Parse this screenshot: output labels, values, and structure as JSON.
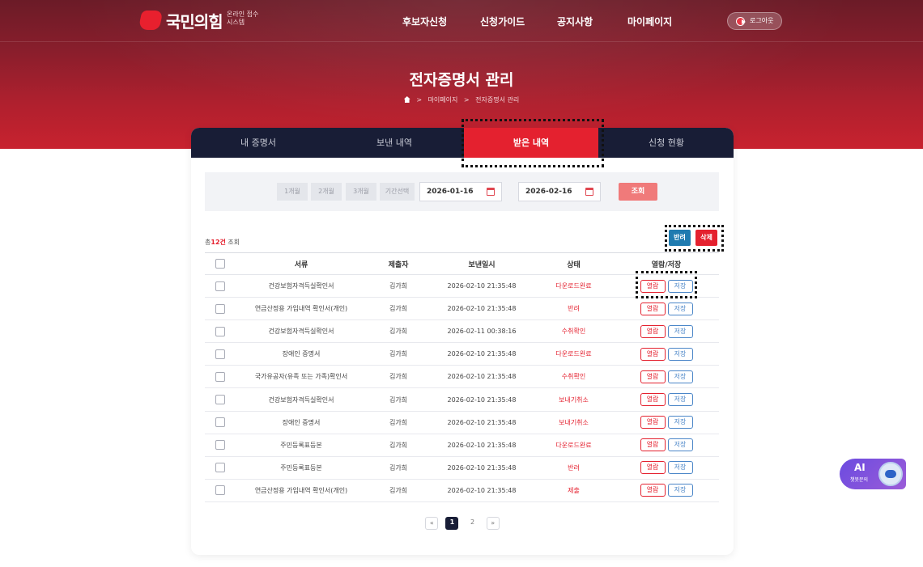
{
  "header": {
    "logo_text": "국민의힘",
    "logo_sub": "온라인 접수 시스템",
    "nav": [
      "후보자신청",
      "신청가이드",
      "공지사항",
      "마이페이지"
    ],
    "logout_label": "로그아웃"
  },
  "page": {
    "title": "전자증명서 관리",
    "breadcrumb": [
      "마이페이지",
      "전자증명서 관리"
    ]
  },
  "tabs": [
    {
      "label": "내 증명서",
      "active": false
    },
    {
      "label": "보낸 내역",
      "active": false
    },
    {
      "label": "받은 내역",
      "active": true
    },
    {
      "label": "신청 현황",
      "active": false
    }
  ],
  "filter": {
    "periods": [
      "1개월",
      "2개월",
      "3개월",
      "기간선택"
    ],
    "start_date": "2026-01-16",
    "end_date": "2026-02-16",
    "search_label": "조회"
  },
  "summary": {
    "prefix": "총",
    "count": "12건",
    "suffix": "조회"
  },
  "actions": {
    "return_label": "반려",
    "delete_label": "삭제"
  },
  "table": {
    "headers": [
      "",
      "서류",
      "제출자",
      "보낸일시",
      "상태",
      "열람/저장"
    ],
    "view_label": "열람",
    "save_label": "저장",
    "rows": [
      {
        "doc": "건강보험자격득실확인서",
        "submitter": "김가희",
        "sent_at": "2026-02-10 21:35:48",
        "status": "다운로드완료"
      },
      {
        "doc": "연금산정용 가입내역 확인서(개인)",
        "submitter": "김가희",
        "sent_at": "2026-02-10 21:35:48",
        "status": "반려"
      },
      {
        "doc": "건강보험자격득실확인서",
        "submitter": "김가희",
        "sent_at": "2026-02-11 00:38:16",
        "status": "수취확인"
      },
      {
        "doc": "장애인 증명서",
        "submitter": "김가희",
        "sent_at": "2026-02-10 21:35:48",
        "status": "다운로드완료"
      },
      {
        "doc": "국가유공자(유족 또는 가족)확인서",
        "submitter": "김가희",
        "sent_at": "2026-02-10 21:35:48",
        "status": "수취확인"
      },
      {
        "doc": "건강보험자격득실확인서",
        "submitter": "김가희",
        "sent_at": "2026-02-10 21:35:48",
        "status": "보내기취소"
      },
      {
        "doc": "장애인 증명서",
        "submitter": "김가희",
        "sent_at": "2026-02-10 21:35:48",
        "status": "보내기취소"
      },
      {
        "doc": "주민등록표등본",
        "submitter": "김가희",
        "sent_at": "2026-02-10 21:35:48",
        "status": "다운로드완료"
      },
      {
        "doc": "주민등록표등본",
        "submitter": "김가희",
        "sent_at": "2026-02-10 21:35:48",
        "status": "반려"
      },
      {
        "doc": "연금산정용 가입내역 확인서(개인)",
        "submitter": "김가희",
        "sent_at": "2026-02-10 21:35:48",
        "status": "제출"
      }
    ]
  },
  "pagination": {
    "prev": "«",
    "pages": [
      "1",
      "2"
    ],
    "current": "1",
    "next": "»"
  },
  "chatbot": {
    "title": "AI",
    "subtitle": "챗봇문의"
  },
  "colors": {
    "brand_red": "#e4212f",
    "navy": "#181d36",
    "return_blue": "#1f7bb0",
    "save_blue": "#4b86c8"
  }
}
